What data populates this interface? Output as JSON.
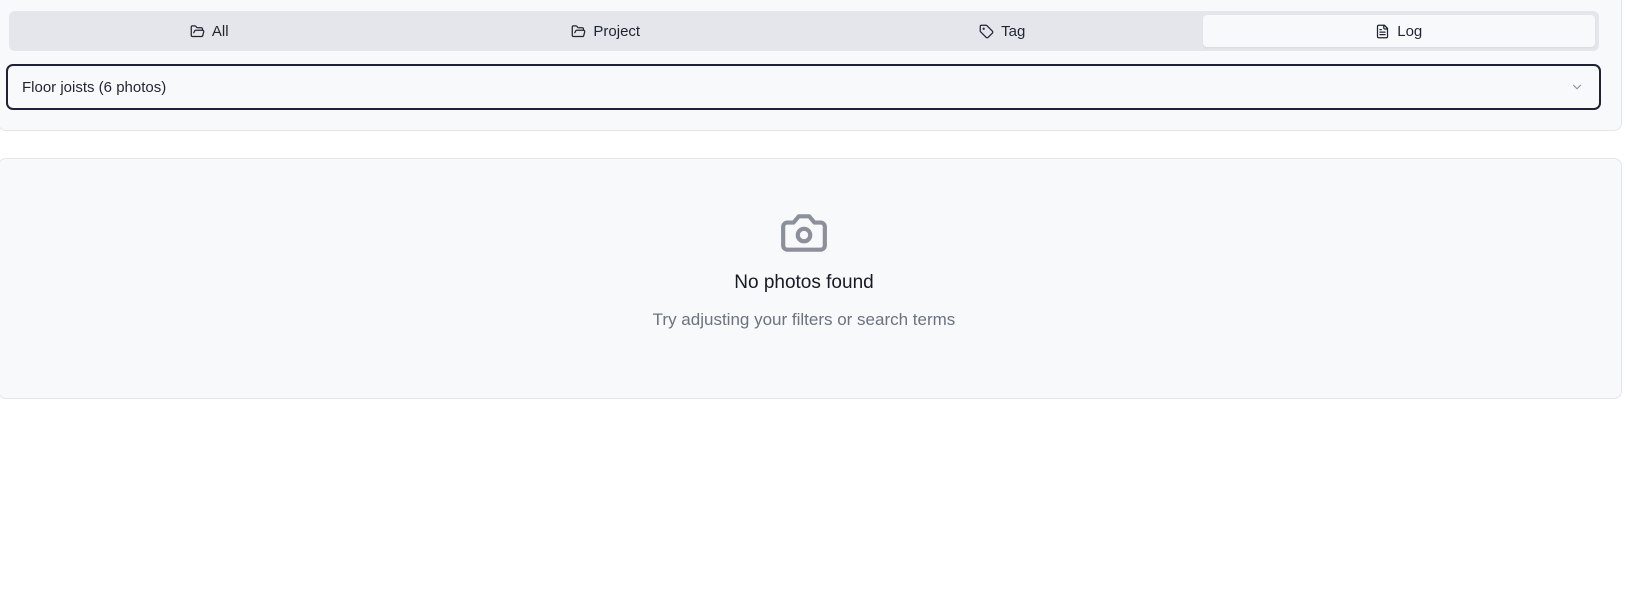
{
  "tabs": [
    {
      "label": "All",
      "icon": "folder-open-icon",
      "active": false
    },
    {
      "label": "Project",
      "icon": "folder-open-icon",
      "active": false
    },
    {
      "label": "Tag",
      "icon": "tag-icon",
      "active": false
    },
    {
      "label": "Log",
      "icon": "file-text-icon",
      "active": true
    }
  ],
  "log_select": {
    "value": "Floor joists (6 photos)",
    "icon": "chevron-down-icon"
  },
  "empty_state": {
    "icon": "camera-icon",
    "title": "No photos found",
    "message": "Try adjusting your filters or search terms"
  },
  "colors": {
    "focus_ring": "#1e2234",
    "card_background": "#f8f9fb",
    "tab_bar_background": "#e4e6eb",
    "muted_text": "#6b7280",
    "icon_gray": "#8b909a"
  }
}
